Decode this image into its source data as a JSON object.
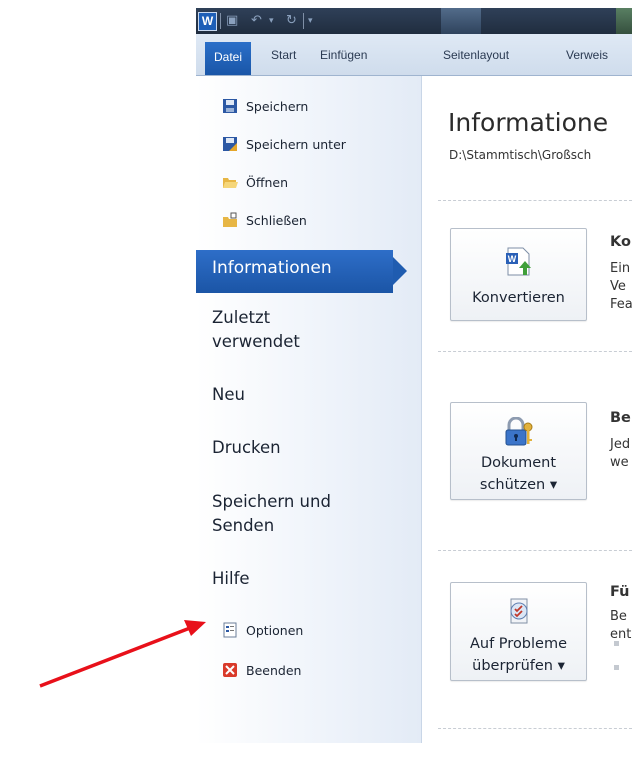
{
  "app": {
    "logo_letter": "W"
  },
  "ribbon": {
    "tabs": [
      "Datei",
      "Start",
      "Einfügen",
      "Seitenlayout",
      "Verweis"
    ]
  },
  "backstage": {
    "top_commands": [
      "Speichern",
      "Speichern unter",
      "Öffnen",
      "Schließen"
    ],
    "selected": "Informationen",
    "big_items": [
      "Zuletzt verwendet",
      "Neu",
      "Drucken",
      "Speichern und Senden",
      "Hilfe"
    ],
    "bottom_commands": [
      "Optionen",
      "Beenden"
    ]
  },
  "main": {
    "title": "Informatione",
    "path": "D:\\Stammtisch\\Großsch",
    "sections": [
      {
        "button": "Konvertieren",
        "heading": "Ko",
        "lines": [
          "Ein",
          "Ve",
          "Fea"
        ]
      },
      {
        "button_lines": [
          "Dokument",
          "schützen ▾"
        ],
        "heading": "Be",
        "lines": [
          "Jed",
          "we"
        ]
      },
      {
        "button_lines": [
          "Auf Probleme",
          "überprüfen ▾"
        ],
        "heading": "Fü",
        "lines": [
          "Be",
          "ent"
        ]
      }
    ]
  },
  "colors": {
    "accent": "#1f5cb0",
    "arrow": "#e8101a"
  }
}
